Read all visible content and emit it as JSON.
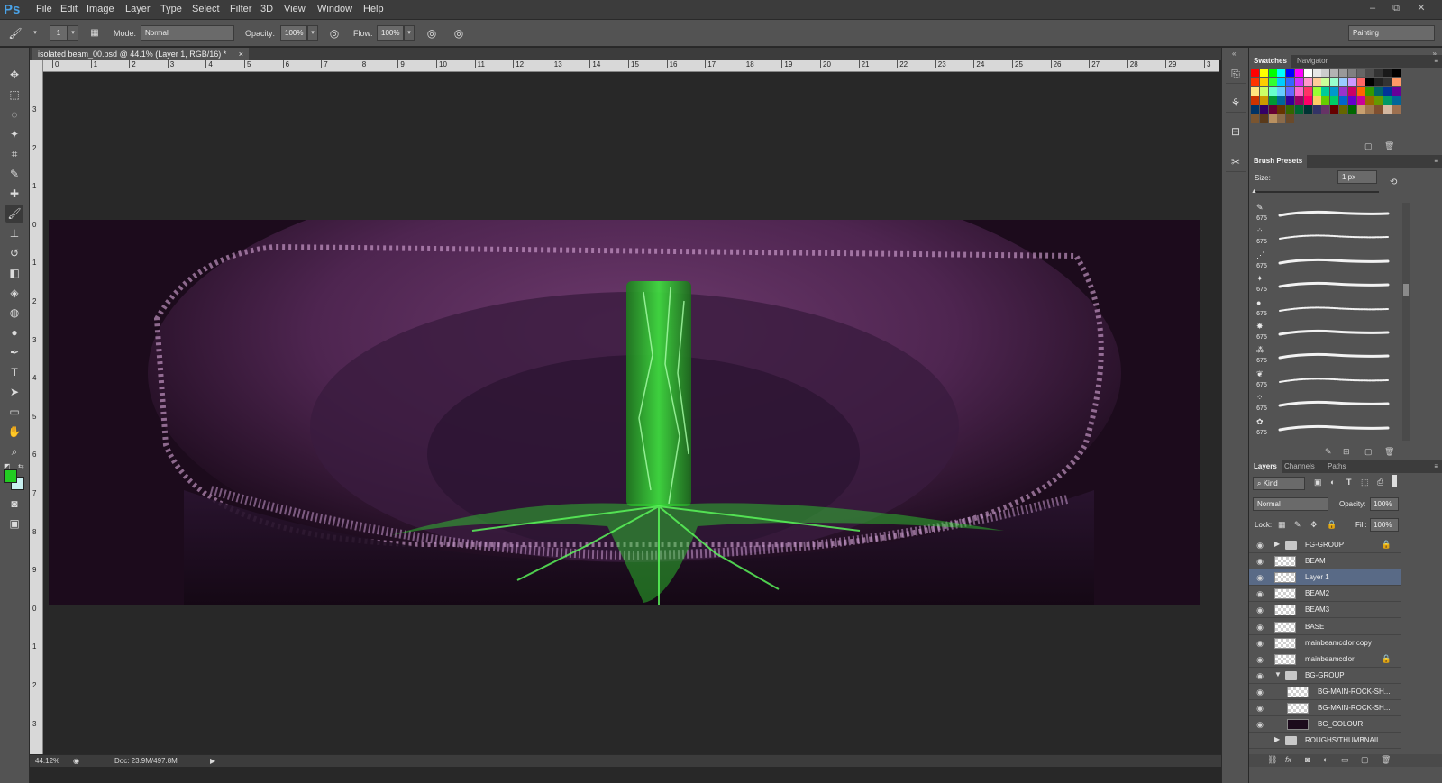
{
  "app": {
    "logo": "Ps"
  },
  "menu": [
    "File",
    "Edit",
    "Image",
    "Layer",
    "Type",
    "Select",
    "Filter",
    "3D",
    "View",
    "Window",
    "Help"
  ],
  "window_controls": {
    "minimize": "–",
    "restore": "⧉",
    "close": "✕"
  },
  "options_bar": {
    "brush_size": "1",
    "mode_label": "Mode:",
    "mode_value": "Normal",
    "opacity_label": "Opacity:",
    "opacity_value": "100%",
    "flow_label": "Flow:",
    "flow_value": "100%",
    "workspace": "Painting"
  },
  "document": {
    "tab_title": "isolated beam_00.psd @ 44.1% (Layer 1, RGB/16) *",
    "tab_close": "×",
    "zoom": "44.12%",
    "doc_size": "Doc: 23.9M/497.8M",
    "ruler_h": [
      "0",
      "1",
      "2",
      "3",
      "4",
      "5",
      "6",
      "7",
      "8",
      "9",
      "10",
      "11",
      "12",
      "13",
      "14",
      "15",
      "16",
      "17",
      "18",
      "19",
      "20",
      "21",
      "22",
      "23",
      "24",
      "25",
      "26",
      "27",
      "28",
      "29",
      "3"
    ],
    "ruler_v": [
      "3",
      "2",
      "1",
      "0",
      "1",
      "2",
      "3",
      "4",
      "5",
      "6",
      "7",
      "8",
      "9",
      "0",
      "1",
      "2",
      "3"
    ]
  },
  "panels": {
    "swatches_tabs": [
      "Swatches",
      "Navigator"
    ],
    "brush_presets": {
      "title": "Brush Presets",
      "size_label": "Size:",
      "size_value": "1 px",
      "items": [
        "675",
        "675",
        "675",
        "675",
        "675",
        "675",
        "675",
        "675",
        "675",
        "675"
      ]
    },
    "layers_tabs": [
      "Layers",
      "Channels",
      "Paths"
    ],
    "kind_label": "Kind",
    "blend_mode": "Normal",
    "opacity_label": "Opacity:",
    "opacity_value": "100%",
    "lock_label": "Lock:",
    "fill_label": "Fill:",
    "fill_value": "100%",
    "layers": [
      {
        "name": "FG-GROUP",
        "type": "group",
        "collapsed": true,
        "locked": true,
        "indent": 0
      },
      {
        "name": "BEAM",
        "type": "layer",
        "indent": 0
      },
      {
        "name": "Layer 1",
        "type": "layer",
        "selected": true,
        "indent": 0
      },
      {
        "name": "BEAM2",
        "type": "layer",
        "indent": 0
      },
      {
        "name": "BEAM3",
        "type": "layer",
        "indent": 0
      },
      {
        "name": "BASE",
        "type": "layer",
        "indent": 0
      },
      {
        "name": "mainbeamcolor copy",
        "type": "layer",
        "indent": 0
      },
      {
        "name": "mainbeamcolor",
        "type": "layer",
        "locked": true,
        "indent": 0
      },
      {
        "name": "BG-GROUP",
        "type": "group",
        "collapsed": false,
        "indent": 0
      },
      {
        "name": "BG-MAIN-ROCK-SH...",
        "type": "layer",
        "indent": 1
      },
      {
        "name": "BG-MAIN-ROCK-SH...",
        "type": "layer",
        "indent": 1
      },
      {
        "name": "BG_COLOUR",
        "type": "layer",
        "dark": true,
        "indent": 1
      },
      {
        "name": "ROUGHS/THUMBNAIL",
        "type": "group",
        "collapsed": true,
        "hidden": true,
        "indent": 0
      }
    ]
  },
  "colors": {
    "foreground": "#22cc22",
    "background": "#c8f0f0",
    "beam": "#2ee82e",
    "cave": "#5a2a5a"
  }
}
